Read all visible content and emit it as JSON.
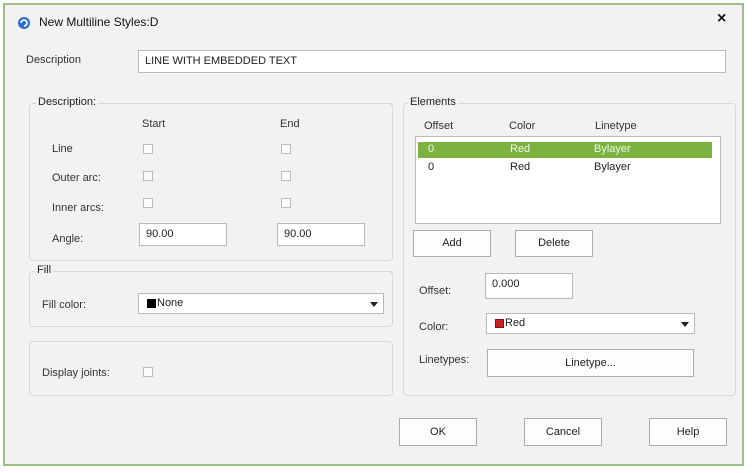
{
  "window": {
    "title": "New Multiline Styles:D",
    "close_glyph": "×"
  },
  "description_row": {
    "label": "Description",
    "value": "LINE WITH EMBEDDED TEXT"
  },
  "caps_group": {
    "title": "Description:",
    "col_start": "Start",
    "col_end": "End",
    "rows": [
      {
        "label": "Line"
      },
      {
        "label": "Outer arc:"
      },
      {
        "label": "Inner arcs:"
      }
    ],
    "angle_label": "Angle:",
    "angle_start": "90.00",
    "angle_end": "90.00"
  },
  "fill_group": {
    "title": "Fill",
    "label": "Fill color:",
    "value": "None",
    "swatch_color": "#000000"
  },
  "joints": {
    "label": "Display joints:"
  },
  "elements_group": {
    "title": "Elements",
    "headers": {
      "offset": "Offset",
      "color": "Color",
      "linetype": "Linetype"
    },
    "rows": [
      {
        "offset": "0",
        "color": "Red",
        "linetype": "Bylayer",
        "selected": true
      },
      {
        "offset": "0",
        "color": "Red",
        "linetype": "Bylayer",
        "selected": false
      }
    ],
    "add_label": "Add",
    "delete_label": "Delete",
    "offset_label": "Offset:",
    "offset_value": "0.000",
    "color_label": "Color:",
    "color_value": "Red",
    "color_swatch": "#cc1f1f",
    "linetypes_label": "Linetypes:",
    "linetype_button": "Linetype..."
  },
  "footer": {
    "ok": "OK",
    "cancel": "Cancel",
    "help": "Help"
  },
  "colors": {
    "accent": "#7ab33f",
    "frame": "#9bbf86",
    "icon_blue": "#2f6fd0"
  }
}
